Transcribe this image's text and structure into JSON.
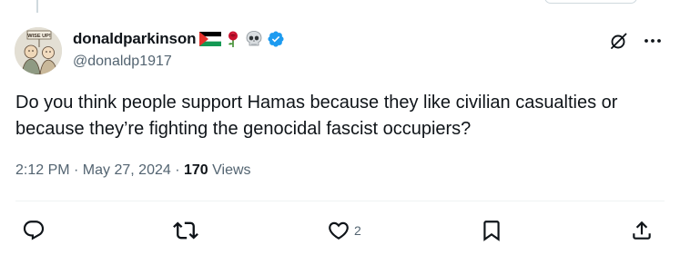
{
  "tweet": {
    "author": {
      "display_name": "donaldparkinson",
      "handle": "@donaldp1917",
      "name_emojis": [
        "palestine-flag",
        "rose",
        "skull"
      ],
      "verified": true,
      "avatar_sign_text": "WISE UP!"
    },
    "text": "Do you think people support Hamas because they like civilian casualties or because they’re fighting the genocidal fascist occupiers?",
    "timestamp": "2:12 PM · May 27, 2024",
    "separator": " · ",
    "views_count": "170",
    "views_label": "Views"
  },
  "actions": {
    "reply_count": "",
    "retweet_count": "",
    "like_count": "2",
    "bookmark_count": "",
    "share_count": ""
  },
  "colors": {
    "text_primary": "#0f1419",
    "text_secondary": "#536471",
    "verified_badge": "#1d9bf0",
    "divider": "#eff3f4"
  }
}
